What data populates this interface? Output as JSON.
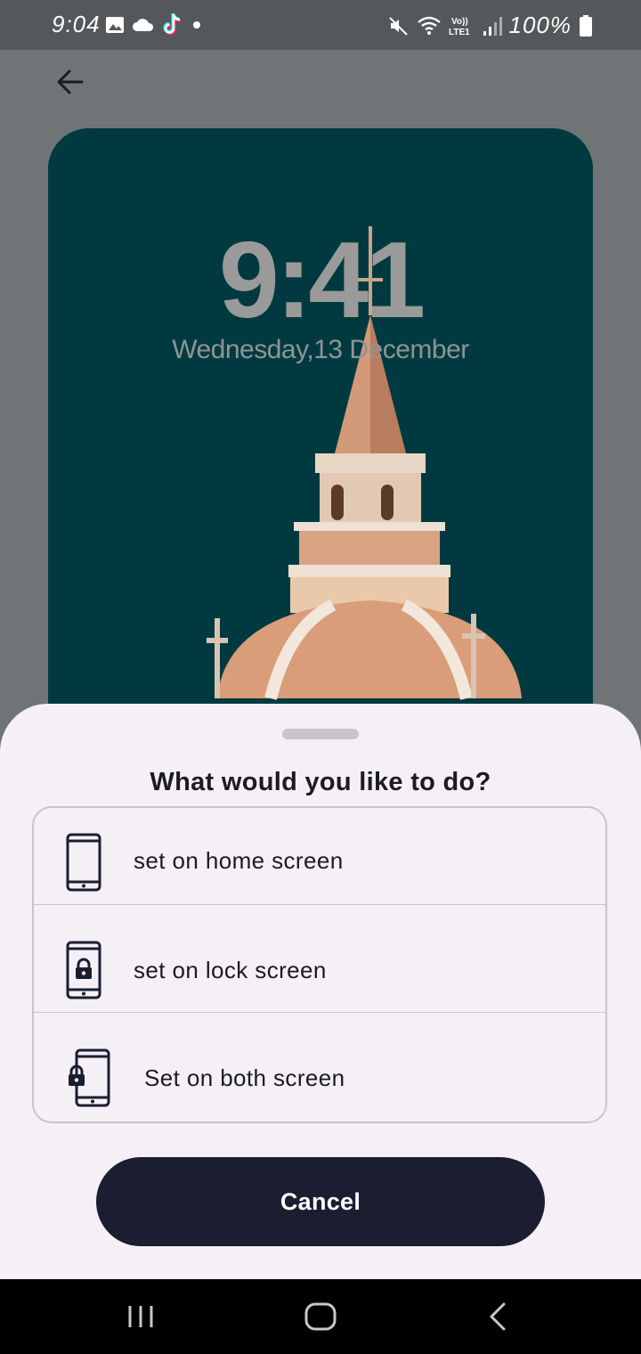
{
  "status_bar": {
    "time": "9:04",
    "battery": "100%",
    "icons": [
      "gallery-icon",
      "cloud-icon",
      "tiktok-icon",
      "dot-icon",
      "mute-icon",
      "wifi-icon",
      "volte-icon",
      "signal-icon",
      "battery-icon"
    ]
  },
  "preview": {
    "clock": "9:41",
    "date": "Wednesday,13 December"
  },
  "sheet": {
    "title": "What would you like to do?",
    "options": [
      {
        "label": "set on home screen",
        "icon": "phone-icon"
      },
      {
        "label": "set on lock screen",
        "icon": "phone-lock-icon"
      },
      {
        "label": "Set on both screen",
        "icon": "phone-both-icon"
      }
    ],
    "cancel_label": "Cancel"
  },
  "colors": {
    "sheet_bg": "#f5f0f6",
    "button_bg": "#1b1e31",
    "preview_bg": "#003840"
  }
}
